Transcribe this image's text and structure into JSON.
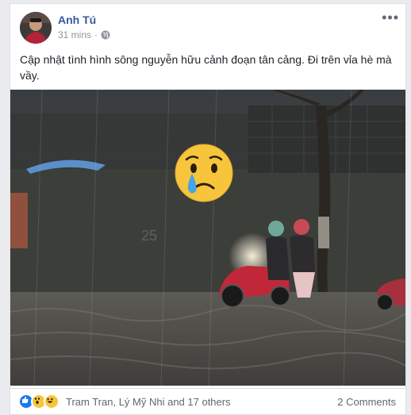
{
  "post": {
    "author": "Anh Tú",
    "time": "31 mins",
    "separator": "·",
    "privacy_icon": "globe-icon",
    "more_label": "•••",
    "text": "Cập nhật tình hình sông nguyễn hữu cảnh đoạn tân cảng. Đi trên vỉa hè mà vầy.",
    "photo_emoji": "sad-crying-emoji"
  },
  "footer": {
    "reactions": [
      "like-reaction-icon",
      "wow-reaction-icon",
      "haha-reaction-icon"
    ],
    "reaction_names": "Tram Tran, Lý Mỹ Nhi and 17 others",
    "comments": "2 Comments"
  },
  "colors": {
    "author_link": "#385898",
    "meta_gray": "#90949c",
    "background": "#e9ebee"
  }
}
